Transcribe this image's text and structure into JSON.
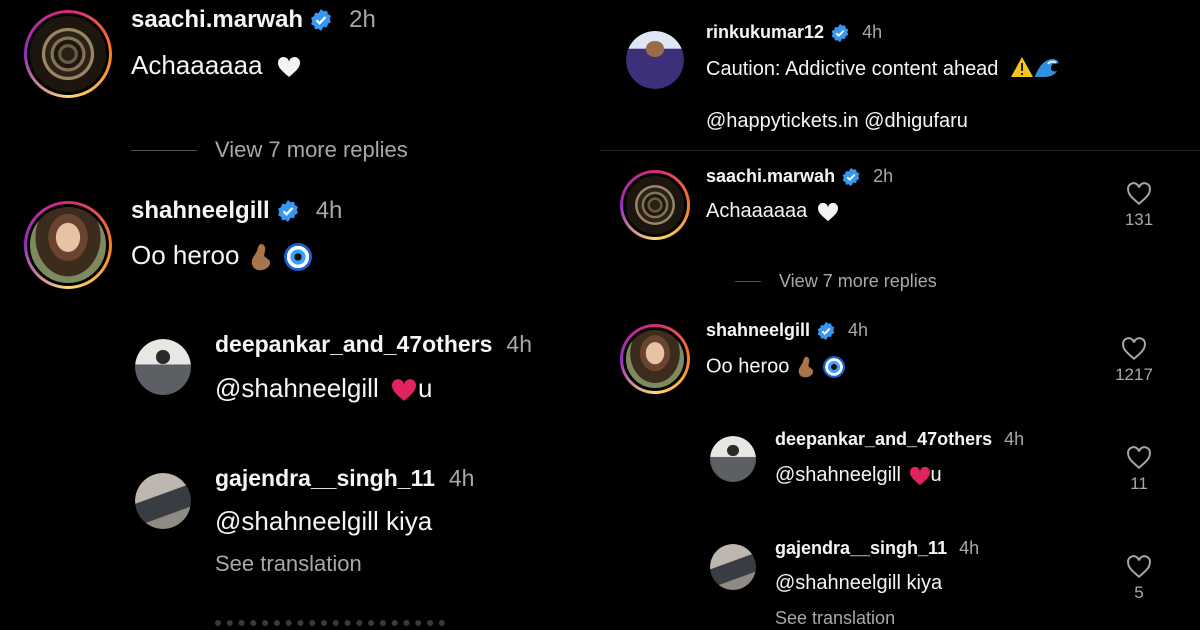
{
  "left": {
    "comments": [
      {
        "username": "saachi.marwah",
        "time": "2h",
        "text": "Achaaaaaa"
      },
      {
        "view_more": "View 7 more replies"
      },
      {
        "username": "shahneelgill",
        "time": "4h",
        "text": "Oo heroo"
      },
      {
        "username": "deepankar_and_47others",
        "time": "4h",
        "text_before": "@shahneelgill",
        "text_after": "u"
      },
      {
        "username": "gajendra__singh_11",
        "time": "4h",
        "text": "@shahneelgill kiya",
        "see_translation": "See translation"
      }
    ]
  },
  "right": {
    "post": {
      "username": "rinkukumar12",
      "time": "4h",
      "caption": "Caution: Addictive content ahead",
      "mentions": "@happytickets.in @dhigufaru"
    },
    "comments": [
      {
        "username": "saachi.marwah",
        "time": "2h",
        "text": "Achaaaaaa",
        "likes": "131"
      },
      {
        "view_more": "View 7 more replies"
      },
      {
        "username": "shahneelgill",
        "time": "4h",
        "text": "Oo heroo",
        "likes": "1217"
      },
      {
        "username": "deepankar_and_47others",
        "time": "4h",
        "text_before": "@shahneelgill",
        "text_after": "u",
        "likes": "11"
      },
      {
        "username": "gajendra__singh_11",
        "time": "4h",
        "text": "@shahneelgill kiya",
        "see_translation": "See translation",
        "likes": "5"
      }
    ]
  },
  "icons": {
    "verified": "verified-badge-icon",
    "like": "heart-outline-icon",
    "white_heart": "white-heart-emoji",
    "red_heart": "red-heart-emoji",
    "warning": "warning-emoji",
    "wave": "wave-emoji",
    "nazar": "nazar-amulet-emoji",
    "pinch": "pinched-fingers-emoji"
  },
  "colors": {
    "background": "#000000",
    "text": "#f5f5f5",
    "muted": "#a8a8a8",
    "verified": "#3897f0",
    "heart_red": "#e0245e"
  }
}
